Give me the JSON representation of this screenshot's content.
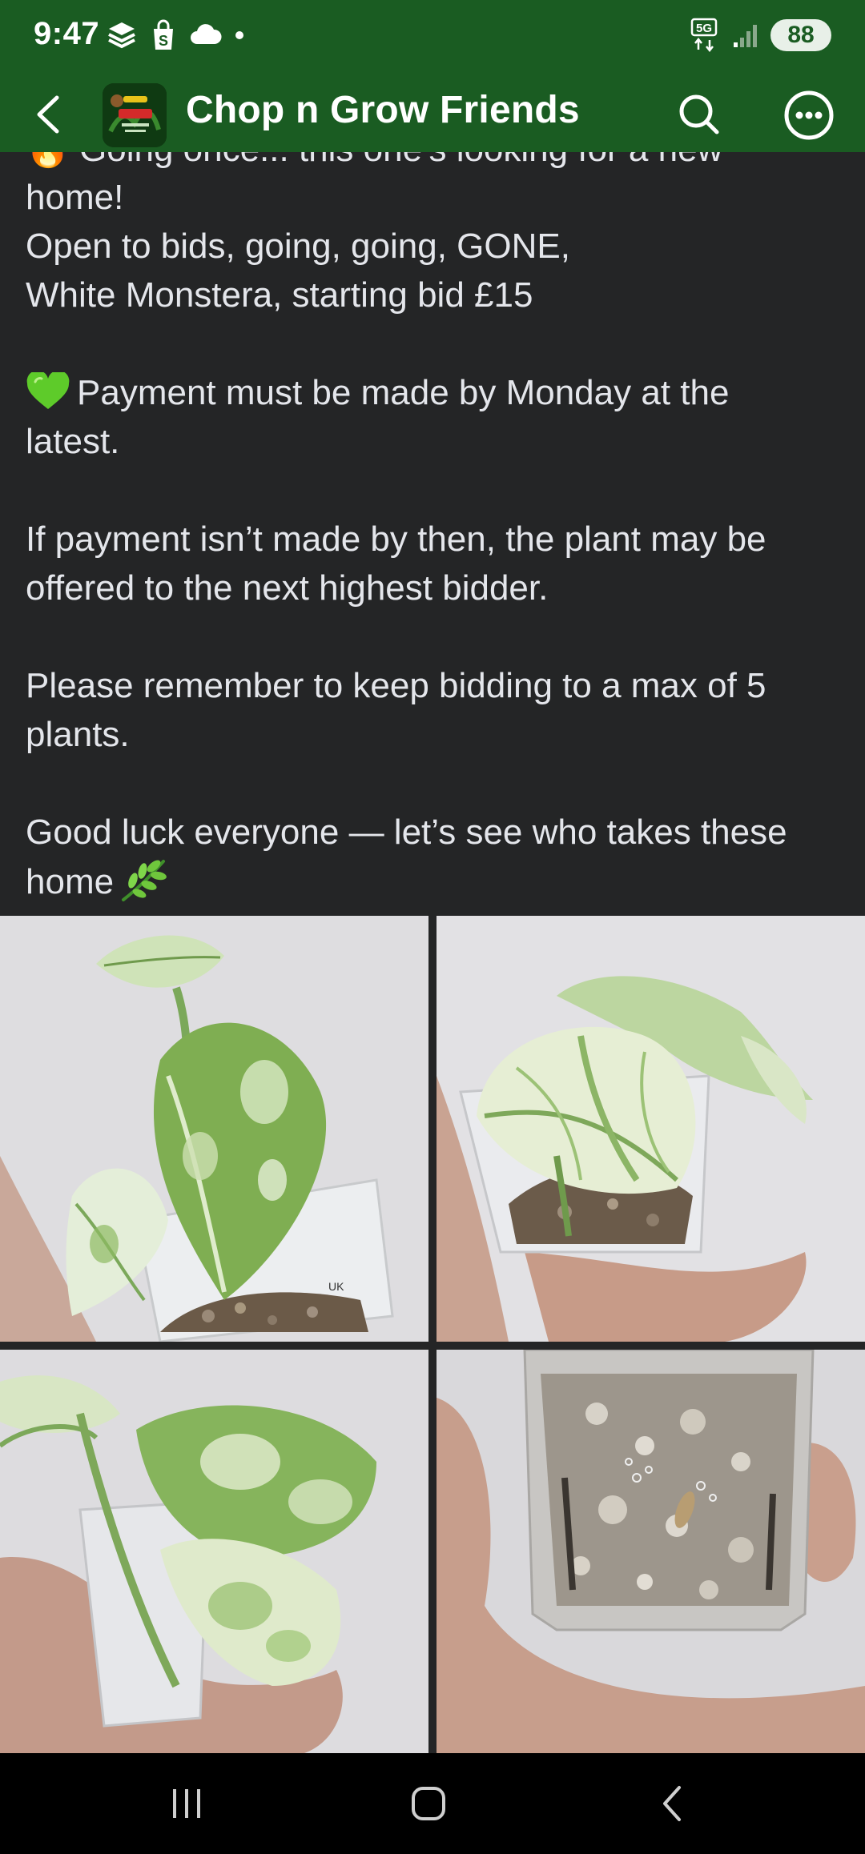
{
  "status_bar": {
    "time": "9:47",
    "network": "5G",
    "battery": "88"
  },
  "app_bar": {
    "title": "Chop n Grow Friends",
    "avatar_text": "Chop n Grow Friends",
    "back_icon": "chevron-left-icon",
    "search_icon": "search-icon",
    "more_icon": "more-horizontal-icon"
  },
  "post": {
    "cut_line": "🔥 Going once... this one's looking for a new",
    "lines": [
      "home!",
      "Open to bids, going, going, GONE,",
      "White Monstera, starting bid £15"
    ],
    "payment": "Payment must be made by Monday at the latest.",
    "payment_line1": "Payment must be made by Monday at the",
    "payment_line2": "latest.",
    "offer_line1": "If payment isn’t made by then, the plant may be",
    "offer_line2": "offered to the next highest bidder.",
    "max_line1": "Please remember to keep bidding to a max of 5",
    "max_line2": "plants.",
    "luck_line1": "Good luck everyone — let’s see who takes these",
    "luck_line2": "home"
  },
  "photos": {
    "count": 4,
    "items": [
      "variegated-monstera-photo",
      "variegated-monstera-photo",
      "variegated-monstera-photo",
      "pot-roots-photo"
    ]
  },
  "nav_bar": {
    "recents_icon": "recents-icon",
    "home_icon": "home-icon",
    "back_icon": "back-icon"
  },
  "colors": {
    "header_green": "#1a5c22",
    "background": "#242526",
    "text": "#e4e6eb"
  }
}
